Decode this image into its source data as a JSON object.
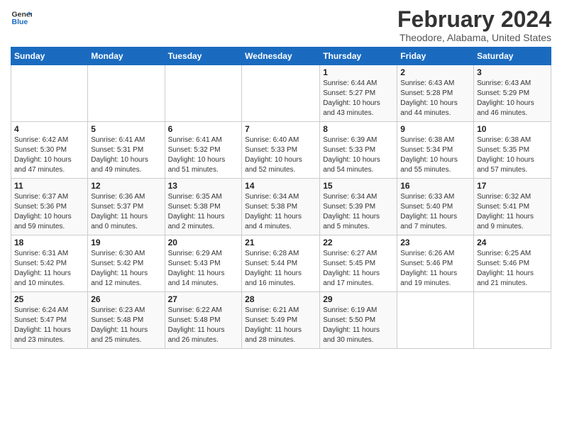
{
  "header": {
    "logo_line1": "General",
    "logo_line2": "Blue",
    "month_title": "February 2024",
    "location": "Theodore, Alabama, United States"
  },
  "weekdays": [
    "Sunday",
    "Monday",
    "Tuesday",
    "Wednesday",
    "Thursday",
    "Friday",
    "Saturday"
  ],
  "weeks": [
    [
      {
        "day": "",
        "info": ""
      },
      {
        "day": "",
        "info": ""
      },
      {
        "day": "",
        "info": ""
      },
      {
        "day": "",
        "info": ""
      },
      {
        "day": "1",
        "info": "Sunrise: 6:44 AM\nSunset: 5:27 PM\nDaylight: 10 hours\nand 43 minutes."
      },
      {
        "day": "2",
        "info": "Sunrise: 6:43 AM\nSunset: 5:28 PM\nDaylight: 10 hours\nand 44 minutes."
      },
      {
        "day": "3",
        "info": "Sunrise: 6:43 AM\nSunset: 5:29 PM\nDaylight: 10 hours\nand 46 minutes."
      }
    ],
    [
      {
        "day": "4",
        "info": "Sunrise: 6:42 AM\nSunset: 5:30 PM\nDaylight: 10 hours\nand 47 minutes."
      },
      {
        "day": "5",
        "info": "Sunrise: 6:41 AM\nSunset: 5:31 PM\nDaylight: 10 hours\nand 49 minutes."
      },
      {
        "day": "6",
        "info": "Sunrise: 6:41 AM\nSunset: 5:32 PM\nDaylight: 10 hours\nand 51 minutes."
      },
      {
        "day": "7",
        "info": "Sunrise: 6:40 AM\nSunset: 5:33 PM\nDaylight: 10 hours\nand 52 minutes."
      },
      {
        "day": "8",
        "info": "Sunrise: 6:39 AM\nSunset: 5:33 PM\nDaylight: 10 hours\nand 54 minutes."
      },
      {
        "day": "9",
        "info": "Sunrise: 6:38 AM\nSunset: 5:34 PM\nDaylight: 10 hours\nand 55 minutes."
      },
      {
        "day": "10",
        "info": "Sunrise: 6:38 AM\nSunset: 5:35 PM\nDaylight: 10 hours\nand 57 minutes."
      }
    ],
    [
      {
        "day": "11",
        "info": "Sunrise: 6:37 AM\nSunset: 5:36 PM\nDaylight: 10 hours\nand 59 minutes."
      },
      {
        "day": "12",
        "info": "Sunrise: 6:36 AM\nSunset: 5:37 PM\nDaylight: 11 hours\nand 0 minutes."
      },
      {
        "day": "13",
        "info": "Sunrise: 6:35 AM\nSunset: 5:38 PM\nDaylight: 11 hours\nand 2 minutes."
      },
      {
        "day": "14",
        "info": "Sunrise: 6:34 AM\nSunset: 5:38 PM\nDaylight: 11 hours\nand 4 minutes."
      },
      {
        "day": "15",
        "info": "Sunrise: 6:34 AM\nSunset: 5:39 PM\nDaylight: 11 hours\nand 5 minutes."
      },
      {
        "day": "16",
        "info": "Sunrise: 6:33 AM\nSunset: 5:40 PM\nDaylight: 11 hours\nand 7 minutes."
      },
      {
        "day": "17",
        "info": "Sunrise: 6:32 AM\nSunset: 5:41 PM\nDaylight: 11 hours\nand 9 minutes."
      }
    ],
    [
      {
        "day": "18",
        "info": "Sunrise: 6:31 AM\nSunset: 5:42 PM\nDaylight: 11 hours\nand 10 minutes."
      },
      {
        "day": "19",
        "info": "Sunrise: 6:30 AM\nSunset: 5:42 PM\nDaylight: 11 hours\nand 12 minutes."
      },
      {
        "day": "20",
        "info": "Sunrise: 6:29 AM\nSunset: 5:43 PM\nDaylight: 11 hours\nand 14 minutes."
      },
      {
        "day": "21",
        "info": "Sunrise: 6:28 AM\nSunset: 5:44 PM\nDaylight: 11 hours\nand 16 minutes."
      },
      {
        "day": "22",
        "info": "Sunrise: 6:27 AM\nSunset: 5:45 PM\nDaylight: 11 hours\nand 17 minutes."
      },
      {
        "day": "23",
        "info": "Sunrise: 6:26 AM\nSunset: 5:46 PM\nDaylight: 11 hours\nand 19 minutes."
      },
      {
        "day": "24",
        "info": "Sunrise: 6:25 AM\nSunset: 5:46 PM\nDaylight: 11 hours\nand 21 minutes."
      }
    ],
    [
      {
        "day": "25",
        "info": "Sunrise: 6:24 AM\nSunset: 5:47 PM\nDaylight: 11 hours\nand 23 minutes."
      },
      {
        "day": "26",
        "info": "Sunrise: 6:23 AM\nSunset: 5:48 PM\nDaylight: 11 hours\nand 25 minutes."
      },
      {
        "day": "27",
        "info": "Sunrise: 6:22 AM\nSunset: 5:48 PM\nDaylight: 11 hours\nand 26 minutes."
      },
      {
        "day": "28",
        "info": "Sunrise: 6:21 AM\nSunset: 5:49 PM\nDaylight: 11 hours\nand 28 minutes."
      },
      {
        "day": "29",
        "info": "Sunrise: 6:19 AM\nSunset: 5:50 PM\nDaylight: 11 hours\nand 30 minutes."
      },
      {
        "day": "",
        "info": ""
      },
      {
        "day": "",
        "info": ""
      }
    ]
  ]
}
